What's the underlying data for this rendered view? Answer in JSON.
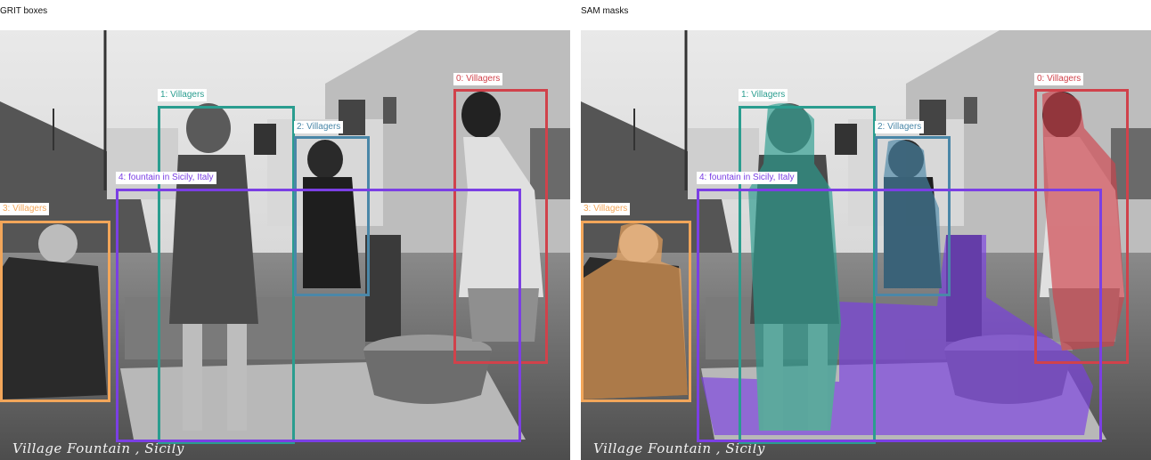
{
  "panels": {
    "left": {
      "title": "GRIT boxes"
    },
    "right": {
      "title": "SAM masks"
    }
  },
  "photo_caption": "Village Fountain , Sicily",
  "detections": [
    {
      "label": "0: Villagers",
      "color": "#d0424b"
    },
    {
      "label": "1: Villagers",
      "color": "#2a9d8f"
    },
    {
      "label": "2: Villagers",
      "color": "#4a87a8"
    },
    {
      "label": "3: Villagers",
      "color": "#f2a65a"
    },
    {
      "label": "4: fountain in Sicily, Italy",
      "color": "#7b3fe4"
    }
  ]
}
